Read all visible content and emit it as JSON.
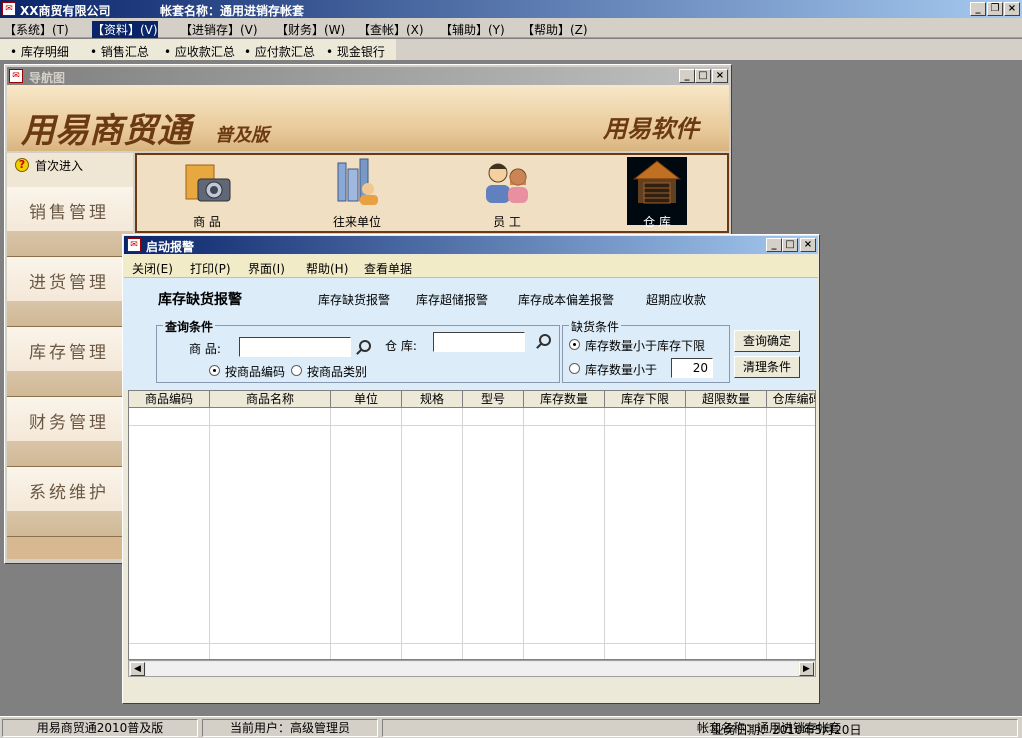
{
  "app": {
    "company": "XX商贸有限公司",
    "account_title": "帐套名称：通用进销存帐套"
  },
  "menu": [
    "【系统】(T)",
    "【资料】(V)",
    "【进销存】(V)",
    "【财务】(W)",
    "【查帐】(X)",
    "【辅助】(Y)",
    "【帮助】(Z)"
  ],
  "toolbar": [
    "库存明细",
    "销售汇总",
    "应收款汇总",
    "应付款汇总",
    "现金银行"
  ],
  "nav": {
    "title": "导航图",
    "brand": "用易商贸通",
    "edition": "普及版",
    "vendor": "用易软件",
    "first_entry": "首次进入",
    "modules": [
      "销售管理",
      "进货管理",
      "库存管理",
      "财务管理",
      "系统维护"
    ],
    "icons": [
      {
        "label": "商 品",
        "icon": "goods-icon"
      },
      {
        "label": "往来单位",
        "icon": "company-icon"
      },
      {
        "label": "员 工",
        "icon": "staff-icon"
      },
      {
        "label": "仓 库",
        "icon": "warehouse-icon"
      }
    ]
  },
  "alarm": {
    "title": "启动报警",
    "menu": [
      "关闭(E)",
      "打印(P)",
      "界面(I)",
      "帮助(H)",
      "查看单据"
    ],
    "heading": "库存缺货报警",
    "tabs": [
      "库存缺货报警",
      "库存超储报警",
      "库存成本偏差报警",
      "超期应收款"
    ],
    "query_group": "查询条件",
    "goods_label": "商  品:",
    "goods_value": "",
    "warehouse_label": "仓  库:",
    "warehouse_value": "",
    "radio_by_code": "按商品编码",
    "radio_by_category": "按商品类别",
    "shortage_group": "缺货条件",
    "cond_below_min": "库存数量小于库存下限",
    "cond_below_value": "库存数量小于",
    "threshold": "20",
    "btn_query": "查询确定",
    "btn_clear": "清理条件",
    "columns": [
      "商品编码",
      "商品名称",
      "单位",
      "规格",
      "型号",
      "库存数量",
      "库存下限",
      "超限数量",
      "仓库编码"
    ]
  },
  "status": {
    "product": "用易商贸通2010普及版",
    "user": "当前用户：高级管理员",
    "account": "帐套名称：通用进销存帐套",
    "date": "业务日期：2010年5月20日"
  }
}
